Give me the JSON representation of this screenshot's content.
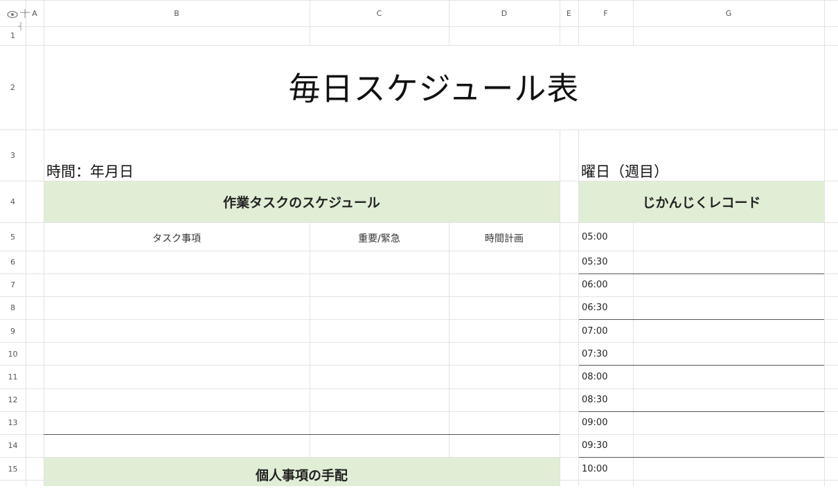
{
  "corner": {
    "eye_icon": "eye-icon",
    "freeze_icon": "freeze-pane-icon"
  },
  "columns": [
    "A",
    "B",
    "C",
    "D",
    "E",
    "F",
    "G"
  ],
  "rows": [
    "1",
    "2",
    "3",
    "4",
    "5",
    "6",
    "7",
    "8",
    "9",
    "10",
    "11",
    "12",
    "13",
    "14",
    "15"
  ],
  "sheet": {
    "title": "毎日スケジュール表",
    "date_label": "時間：年月日",
    "weekday_label": "曜日（週目）",
    "task_banner": "作業タスクのスケジュール",
    "record_banner": "じかんじくレコード",
    "task_headers": [
      "タスク事項",
      "重要/緊急",
      "時間計画"
    ],
    "personal_banner": "個人事項の手配",
    "times": [
      "05:00",
      "05:30",
      "06:00",
      "06:30",
      "07:00",
      "07:30",
      "08:00",
      "08:30",
      "09:00",
      "09:30",
      "10:00"
    ]
  },
  "colors": {
    "banner_green": "#e1eed6",
    "grid": "#e3e3e3"
  }
}
